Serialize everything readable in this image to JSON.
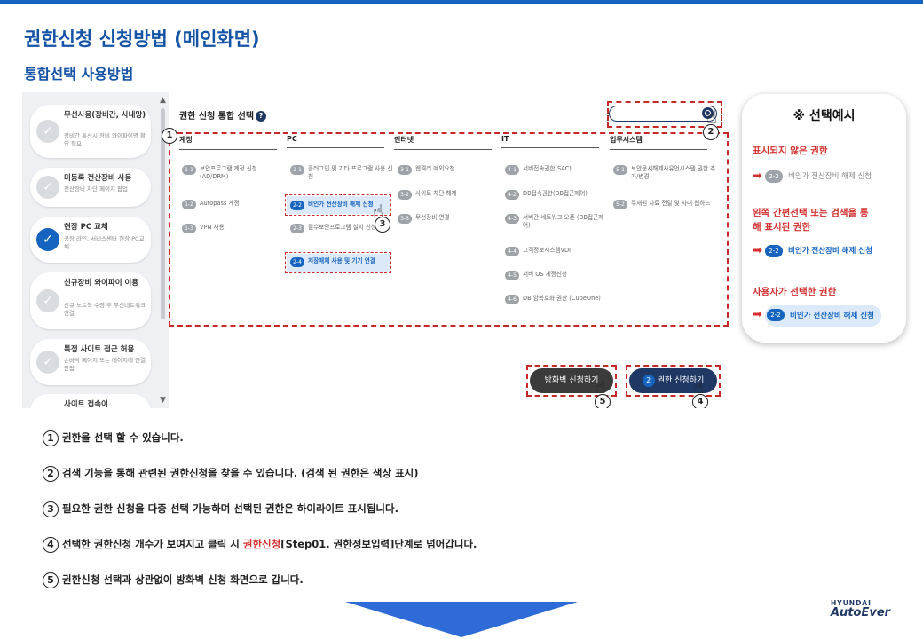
{
  "title": "권한신청 신청방법 (메인화면)",
  "subtitle": "통합선택 사용방법",
  "sidebar": {
    "cards": [
      {
        "title": "무선사용(장비간, 사내망)",
        "desc": "장비간 통신시 장비 와이파이명 확인 필요",
        "active": false
      },
      {
        "title": "미등록 전산장비 사용",
        "desc": "전산장비 차단 페이지 팝업",
        "active": false
      },
      {
        "title": "현장 PC 교체",
        "desc": "공장 라인, 서비스센터 현장 PC교체",
        "active": true
      },
      {
        "title": "신규장비 와이파이 이용",
        "desc": "신규 노트북 수령 후 무선네트워크 연결",
        "active": false
      },
      {
        "title": "특정 사이트 접근 허용",
        "desc": "손바닥 페이지 또는 메이지에 연결 안됨",
        "active": false
      },
      {
        "title": "사이트 접속이",
        "desc": "",
        "active": false
      }
    ]
  },
  "main": {
    "title": "권한 신청 통합 선택",
    "help": "?",
    "columns": [
      {
        "header": "계정",
        "items": [
          {
            "num": "1-1",
            "text": "보안프로그램 계정 신청 (AD/DRM)"
          },
          {
            "num": "1-2",
            "text": "Autopass 계정"
          },
          {
            "num": "1-3",
            "text": "VPN 사용"
          }
        ]
      },
      {
        "header": "PC",
        "items": [
          {
            "num": "2-1",
            "text": "플러그인 및 기타 프로그램 사용 신청"
          },
          {
            "num": "2-2",
            "text": "비인가 전산장비 해제 신청",
            "selected": true
          },
          {
            "num": "2-3",
            "text": "필수보안프로그램 설치 신청"
          },
          {
            "num": "2-4",
            "text": "저장매체 사용 및 기기 연결",
            "selected": true
          }
        ]
      },
      {
        "header": "인터넷",
        "items": [
          {
            "num": "3-1",
            "text": "웹격리 예외요청"
          },
          {
            "num": "3-2",
            "text": "사이트 차단 해제"
          },
          {
            "num": "3-3",
            "text": "무선장비 연결"
          }
        ]
      },
      {
        "header": "IT",
        "items": [
          {
            "num": "4-1",
            "text": "서버접속권한(SAC)"
          },
          {
            "num": "4-2",
            "text": "DB접속권한(DB접근제어)"
          },
          {
            "num": "4-3",
            "text": "서버간 네트워크 오픈 (DB접근제어)"
          },
          {
            "num": "4-4",
            "text": "고객정보시스템VDI"
          },
          {
            "num": "4-5",
            "text": "서버 OS 계정신청"
          },
          {
            "num": "4-6",
            "text": "DB 암복호화 권한 (CubeOne)"
          }
        ]
      },
      {
        "header": "업무시스템",
        "items": [
          {
            "num": "5-1",
            "text": "보안문서해제사유언시스템 권한 추가/변경"
          },
          {
            "num": "5-2",
            "text": "주재원 자료 전달 및 사내 웹하드"
          }
        ]
      }
    ],
    "btn_firewall": "방화벽 신청하기",
    "btn_apply_count": "2",
    "btn_apply": "권한 신청하기",
    "markers": [
      "1",
      "2",
      "3",
      "4",
      "5"
    ]
  },
  "example": {
    "title": "※ 선택예시",
    "sections": [
      {
        "label": "표시되지 않은 권한",
        "num": "2-2",
        "text": "비인가 전산장비 해제 신청",
        "style": "gray"
      },
      {
        "label": "왼쪽 간편선택 또는 검색을 통해 표시된 권한",
        "num": "2-2",
        "text": "비인가 전산장비 해제 신청",
        "style": "blue"
      },
      {
        "label": "사용자가 선택한 권한",
        "num": "2-2",
        "text": "비인가 전산장비 해제 신청",
        "style": "selected"
      }
    ]
  },
  "steps": [
    {
      "n": "1",
      "text": "권한을 선택 할 수 있습니다."
    },
    {
      "n": "2",
      "text": "검색 기능을 통해 관련된 권한신청을 찾을 수 있습니다. (검색 된 권한은 색상 표시)"
    },
    {
      "n": "3",
      "text": "필요한 권한 신청을 다중 선택 가능하며 선택된 권한은 하이라이트 표시됩니다."
    },
    {
      "n": "4",
      "pre": "선택한 권한신청 개수가 보여지고 클릭 시 ",
      "red": "권한신청",
      "post": "[Step01. 권한정보입력]단계로 넘어갑니다."
    },
    {
      "n": "5",
      "text": "권한신청 선택과 상관없이 방화벽 신청 화면으로 갑니다."
    }
  ],
  "logo": {
    "line1": "HYUNDAI",
    "line2": "AutoEver"
  },
  "colors": {
    "brand_blue": "#1553a6",
    "accent_red": "#d32f2f",
    "navy": "#1f3864"
  }
}
